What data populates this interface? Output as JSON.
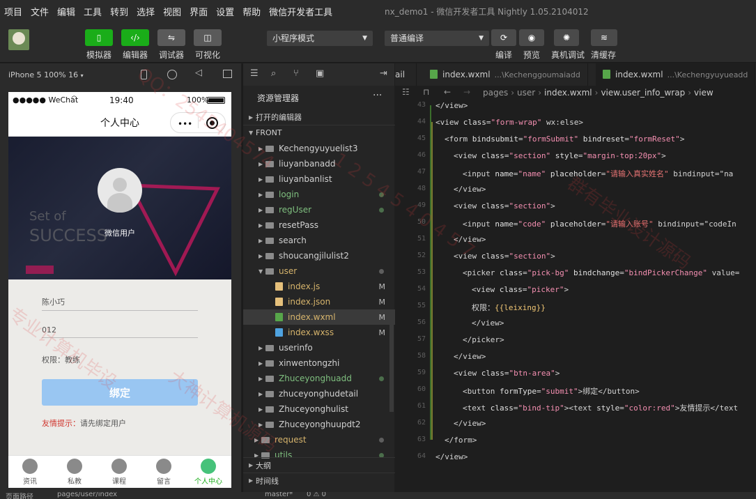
{
  "menubar": {
    "items": [
      "项目",
      "文件",
      "编辑",
      "工具",
      "转到",
      "选择",
      "视图",
      "界面",
      "设置",
      "帮助",
      "微信开发者工具"
    ],
    "window_title": "nx_demo1 - 微信开发者工具 Nightly 1.05.2104012"
  },
  "toolbar": {
    "left_buttons": [
      {
        "label": "模拟器",
        "icon": "phone-icon",
        "color": "#1aad19"
      },
      {
        "label": "编辑器",
        "icon": "code-icon",
        "color": "#1aad19"
      },
      {
        "label": "调试器",
        "icon": "debug-toggle-icon",
        "color": "#5a5a5a"
      },
      {
        "label": "可视化",
        "icon": "layout-icon",
        "color": "#5a5a5a"
      }
    ],
    "mode_select": "小程序模式",
    "compile_select": "普通编译",
    "right_buttons": [
      {
        "label": "编译",
        "icon": "refresh-icon"
      },
      {
        "label": "预览",
        "icon": "eye-icon"
      },
      {
        "label": "真机调试",
        "icon": "bug-icon"
      },
      {
        "label": "清缓存",
        "icon": "layers-icon"
      }
    ]
  },
  "simulator": {
    "device": "iPhone 5 100% 16",
    "status_bar": {
      "carrier": "●●●●● WeChat",
      "time": "19:40",
      "battery": "100%"
    },
    "nav_title": "个人中心",
    "username": "微信用户",
    "form": {
      "name_value": "陈小巧",
      "code_value": "012",
      "permission_label": "权限：",
      "permission_value": "教练",
      "bind_button": "绑定",
      "tip_label": "友情提示：",
      "tip_text": "请先绑定用户"
    },
    "tabs": [
      "资讯",
      "私教",
      "课程",
      "留言",
      "个人中心"
    ],
    "active_tab": 4
  },
  "explorer": {
    "title": "资源管理器",
    "open_editors": "打开的编辑器",
    "project": "FRONT",
    "items": [
      {
        "name": "Kechengyuyuelist3",
        "type": "folder",
        "indent": 1,
        "dot": false
      },
      {
        "name": "liuyanbanadd",
        "type": "folder",
        "indent": 1,
        "dot": false
      },
      {
        "name": "liuyanbanlist",
        "type": "folder",
        "indent": 1,
        "dot": false
      },
      {
        "name": "login",
        "type": "folder",
        "indent": 1,
        "dot": true,
        "color": "#7fbf7f"
      },
      {
        "name": "regUser",
        "type": "folder",
        "indent": 1,
        "dot": true,
        "color": "#7fbf7f"
      },
      {
        "name": "resetPass",
        "type": "folder",
        "indent": 1,
        "dot": false
      },
      {
        "name": "search",
        "type": "folder",
        "indent": 1,
        "dot": false
      },
      {
        "name": "shoucangjilulist2",
        "type": "folder",
        "indent": 1,
        "dot": false
      },
      {
        "name": "user",
        "type": "folder-open",
        "indent": 1,
        "dot": true,
        "color": "#d6b46c"
      },
      {
        "name": "index.js",
        "type": "js",
        "indent": 2,
        "flag": "M",
        "color": "#d6b46c"
      },
      {
        "name": "index.json",
        "type": "json",
        "indent": 2,
        "flag": "M",
        "color": "#d6b46c"
      },
      {
        "name": "index.wxml",
        "type": "wxml",
        "indent": 2,
        "flag": "M",
        "color": "#d6b46c",
        "selected": true
      },
      {
        "name": "index.wxss",
        "type": "wxss",
        "indent": 2,
        "flag": "M",
        "color": "#d6b46c"
      },
      {
        "name": "userinfo",
        "type": "folder",
        "indent": 1,
        "dot": false
      },
      {
        "name": "xinwentongzhi",
        "type": "folder",
        "indent": 1,
        "dot": false
      },
      {
        "name": "Zhuceyonghuadd",
        "type": "folder",
        "indent": 1,
        "dot": true,
        "color": "#7fbf7f"
      },
      {
        "name": "zhuceyonghudetail",
        "type": "folder",
        "indent": 1,
        "dot": false
      },
      {
        "name": "Zhuceyonghulist",
        "type": "folder",
        "indent": 1,
        "dot": false
      },
      {
        "name": "Zhuceyonghuupdt2",
        "type": "folder",
        "indent": 1,
        "dot": false
      },
      {
        "name": "request",
        "type": "folder",
        "indent": 0,
        "dot": true,
        "color": "#d6b46c"
      },
      {
        "name": "utils",
        "type": "folder",
        "indent": 0,
        "dot": true,
        "color": "#7fbf7f"
      }
    ],
    "outline": "大纲",
    "timeline": "时间线"
  },
  "editor_tabs": [
    {
      "name": "ail",
      "path": ""
    },
    {
      "name": "index.wxml",
      "path": "...\\Kechenggoumaiadd"
    },
    {
      "name": "index.wxml",
      "path": "...\\Kechengyuyueadd"
    }
  ],
  "breadcrumbs": [
    "pages",
    "user",
    "index.wxml",
    "view.user_info_wrap",
    "view"
  ],
  "code_lines": [
    {
      "n": "43",
      "indent": 1,
      "html": "</view>"
    },
    {
      "n": "44",
      "indent": 1,
      "html": "<view class=\"form-wrap\" wx:else>"
    },
    {
      "n": "45",
      "indent": 2,
      "html": "<form bindsubmit=\"formSubmit\" bindreset=\"formReset\">"
    },
    {
      "n": "46",
      "indent": 3,
      "html": "<view class=\"section\" style=\"margin-top:20px\">"
    },
    {
      "n": "47",
      "indent": 4,
      "html": "<input name=\"name\" placeholder=\"请输入真实姓名\" bindinput=\"na"
    },
    {
      "n": "48",
      "indent": 3,
      "html": "</view>"
    },
    {
      "n": "49",
      "indent": 3,
      "html": "<view class=\"section\">"
    },
    {
      "n": "50",
      "indent": 4,
      "html": "<input name=\"code\" placeholder=\"请输入账号\" bindinput=\"codeIn"
    },
    {
      "n": "51",
      "indent": 3,
      "html": "</view>"
    },
    {
      "n": "52",
      "indent": 3,
      "html": "<view class=\"section\">"
    },
    {
      "n": "53",
      "indent": 4,
      "html": "<picker class=\"pick-bg\" bindchange=\"bindPickerChange\" value="
    },
    {
      "n": "54",
      "indent": 5,
      "html": "<view class=\"picker\">"
    },
    {
      "n": "55",
      "indent": 5,
      "html": "权限：{{leixing}}"
    },
    {
      "n": "56",
      "indent": 5,
      "html": "</view>"
    },
    {
      "n": "57",
      "indent": 4,
      "html": "</picker>"
    },
    {
      "n": "58",
      "indent": 3,
      "html": "</view>"
    },
    {
      "n": "59",
      "indent": 3,
      "html": "<view class=\"btn-area\">"
    },
    {
      "n": "60",
      "indent": 4,
      "html": "<button formType=\"submit\">绑定</button>"
    },
    {
      "n": "61",
      "indent": 4,
      "html": "<text class=\"bind-tip\"><text style=\"color:red\">友情提示</text"
    },
    {
      "n": "62",
      "indent": 3,
      "html": "</view>"
    },
    {
      "n": "63",
      "indent": 2,
      "html": "</form>"
    },
    {
      "n": "64",
      "indent": 1,
      "html": "</view>"
    }
  ],
  "bottom": {
    "page_path_label": "页面路径",
    "page_path": "pages/user/index",
    "git_branch": "master*",
    "problems": "0 ⚠ 0"
  },
  "watermarks": [
    "大神计算机源码",
    "QQ：2545404574",
    "1 2 5 4 5 4 0 4 5 7",
    "专业计算机毕设",
    "群有毕业设计源码"
  ]
}
